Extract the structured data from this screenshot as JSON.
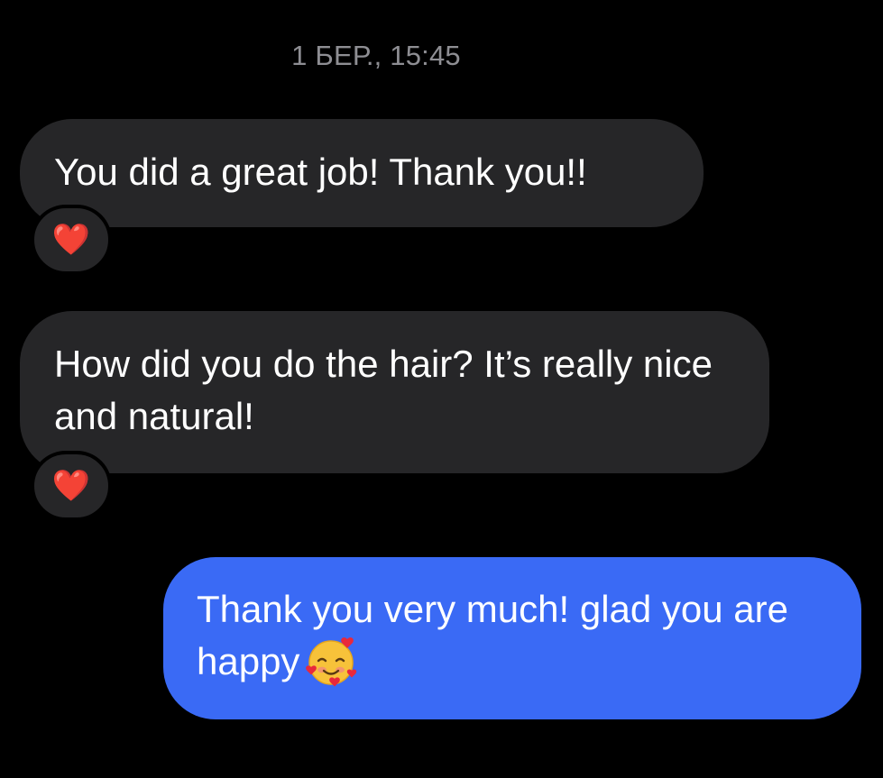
{
  "timestamp": "1 БЕР., 15:45",
  "messages": [
    {
      "direction": "incoming",
      "text": "You did a great job! Thank you!!",
      "reaction": "❤️"
    },
    {
      "direction": "incoming",
      "text": "How did you do the hair? It’s really nice and natural!",
      "reaction": "❤️"
    },
    {
      "direction": "outgoing",
      "text": "Thank you very much!  glad you are happy",
      "emoji": "smiling-face-with-hearts"
    }
  ],
  "colors": {
    "background": "#000000",
    "incoming_bubble": "#262628",
    "outgoing_bubble": "#3a6af5",
    "timestamp_text": "#8e8e93",
    "heart": "#ff2d2d"
  }
}
